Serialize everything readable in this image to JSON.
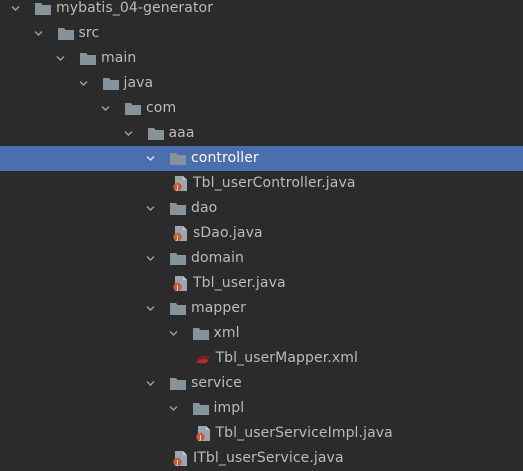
{
  "project_tree": {
    "nodes": [
      {
        "label": "mybatis_04-generator",
        "type": "folder",
        "depth": 0,
        "expanded": true,
        "selected": false
      },
      {
        "label": "src",
        "type": "folder",
        "depth": 1,
        "expanded": true,
        "selected": false
      },
      {
        "label": "main",
        "type": "folder",
        "depth": 2,
        "expanded": true,
        "selected": false
      },
      {
        "label": "java",
        "type": "folder",
        "depth": 3,
        "expanded": true,
        "selected": false
      },
      {
        "label": "com",
        "type": "folder",
        "depth": 4,
        "expanded": true,
        "selected": false
      },
      {
        "label": "aaa",
        "type": "folder",
        "depth": 5,
        "expanded": true,
        "selected": false
      },
      {
        "label": "controller",
        "type": "folder",
        "depth": 6,
        "expanded": true,
        "selected": true
      },
      {
        "label": "Tbl_userController.java",
        "type": "java-file",
        "depth": 7,
        "selected": false
      },
      {
        "label": "dao",
        "type": "folder",
        "depth": 6,
        "expanded": true,
        "selected": false
      },
      {
        "label": "sDao.java",
        "type": "java-file",
        "depth": 7,
        "selected": false
      },
      {
        "label": "domain",
        "type": "folder",
        "depth": 6,
        "expanded": true,
        "selected": false
      },
      {
        "label": "Tbl_user.java",
        "type": "java-file",
        "depth": 7,
        "selected": false
      },
      {
        "label": "mapper",
        "type": "folder",
        "depth": 6,
        "expanded": true,
        "selected": false
      },
      {
        "label": "xml",
        "type": "folder",
        "depth": 7,
        "expanded": true,
        "selected": false
      },
      {
        "label": "Tbl_userMapper.xml",
        "type": "mybatis-xml-file",
        "depth": 8,
        "selected": false
      },
      {
        "label": "service",
        "type": "folder",
        "depth": 6,
        "expanded": true,
        "selected": false
      },
      {
        "label": "impl",
        "type": "folder",
        "depth": 7,
        "expanded": true,
        "selected": false
      },
      {
        "label": "Tbl_userServiceImpl.java",
        "type": "java-file",
        "depth": 8,
        "selected": false
      },
      {
        "label": "ITbl_userService.java",
        "type": "java-file",
        "depth": 7,
        "selected": false
      }
    ]
  },
  "colors": {
    "background": "#2b2b2b",
    "selection": "#4b6eaf",
    "text": "#bbbbbb",
    "folder": "#87939a",
    "java_badge": "#c75c3c"
  }
}
